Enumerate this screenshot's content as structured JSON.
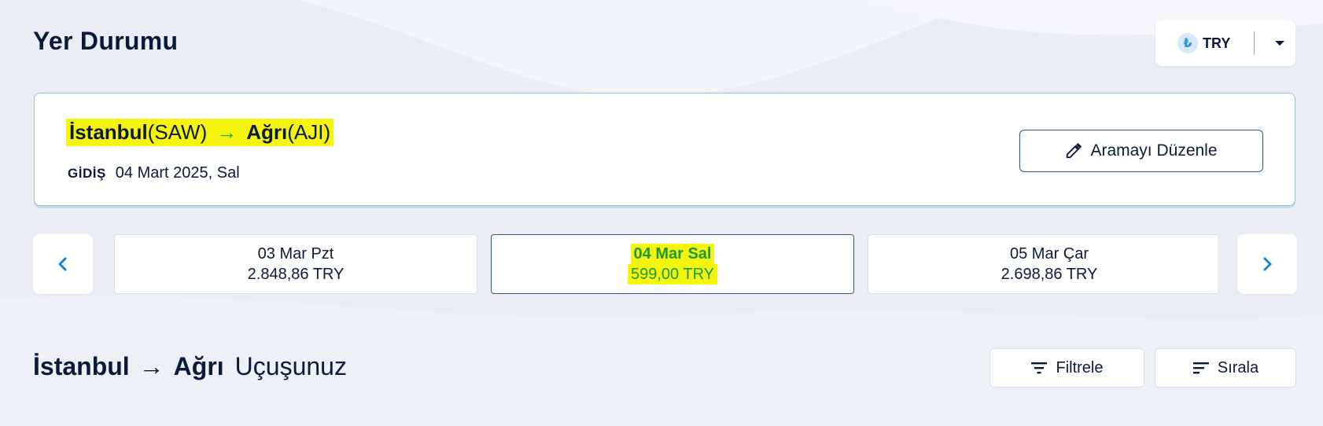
{
  "header": {
    "title": "Yer Durumu"
  },
  "currency": {
    "symbol": "₺",
    "code": "TRY"
  },
  "search": {
    "origin_city": "İstanbul",
    "origin_code": "(SAW)",
    "arrow": "→",
    "destination_city": "Ağrı",
    "destination_code": "(AJI)",
    "departure_label": "GİDİŞ",
    "departure_date": "04 Mart 2025, Sal",
    "edit_label": "Aramayı Düzenle"
  },
  "date_nav": {
    "prev": "‹",
    "next": "›",
    "dates": [
      {
        "day": "03 Mar Pzt",
        "price": "2.848,86 TRY",
        "selected": false
      },
      {
        "day": "04 Mar Sal",
        "price": "599,00 TRY",
        "selected": true
      },
      {
        "day": "05 Mar Çar",
        "price": "2.698,86 TRY",
        "selected": false
      }
    ]
  },
  "results": {
    "origin": "İstanbul",
    "arrow": "→",
    "destination": "Ağrı",
    "suffix": "Uçuşunuz",
    "filter_label": "Filtrele",
    "sort_label": "Sırala"
  },
  "colors": {
    "accent": "#1f5a92",
    "highlight": "#f4f40e",
    "selected_text": "#1a9a3a",
    "route_arrow": "#1aa64a"
  }
}
